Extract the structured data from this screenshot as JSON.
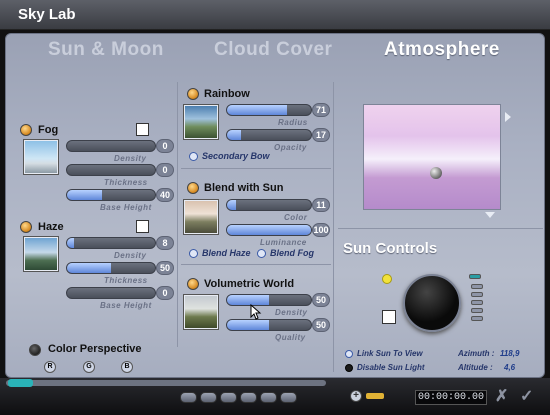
{
  "app": {
    "title": "Sky Lab"
  },
  "tabs": [
    {
      "label": "Sun & Moon",
      "active": false
    },
    {
      "label": "Cloud Cover",
      "active": false
    },
    {
      "label": "Atmosphere",
      "active": true
    }
  ],
  "fog": {
    "label": "Fog",
    "sliders": [
      {
        "caption": "Density",
        "value": "0",
        "fraction": 0.0
      },
      {
        "caption": "Thickness",
        "value": "0",
        "fraction": 0.0
      },
      {
        "caption": "Base Height",
        "value": "40",
        "fraction": 0.4
      }
    ]
  },
  "haze": {
    "label": "Haze",
    "sliders": [
      {
        "caption": "Density",
        "value": "8",
        "fraction": 0.08
      },
      {
        "caption": "Thickness",
        "value": "50",
        "fraction": 0.5
      },
      {
        "caption": "Base Height",
        "value": "0",
        "fraction": 0.0
      }
    ]
  },
  "rainbow": {
    "label": "Rainbow",
    "sliders": [
      {
        "caption": "Radius",
        "value": "71",
        "fraction": 0.71
      },
      {
        "caption": "Opacity",
        "value": "17",
        "fraction": 0.17
      }
    ],
    "option": "Secondary Bow"
  },
  "blend": {
    "label": "Blend with Sun",
    "sliders": [
      {
        "caption": "Color",
        "value": "11",
        "fraction": 0.11
      },
      {
        "caption": "Luminance",
        "value": "100",
        "fraction": 1.0
      }
    ],
    "options": [
      "Blend Haze",
      "Blend Fog"
    ]
  },
  "volumetric": {
    "label": "Volumetric World",
    "sliders": [
      {
        "caption": "Density",
        "value": "50",
        "fraction": 0.5
      },
      {
        "caption": "Quality",
        "value": "50",
        "fraction": 0.5
      }
    ]
  },
  "color_perspective": {
    "label": "Color Perspective",
    "channels": [
      "R",
      "G",
      "B"
    ]
  },
  "sun_controls": {
    "title": "Sun Controls",
    "link_label": "Link Sun To View",
    "disable_label": "Disable Sun Light",
    "azimuth_label": "Azimuth :",
    "azimuth_value": "118,9",
    "altitude_label": "Altitude :",
    "altitude_value": "4,6"
  },
  "timeline": {
    "time": "00:00:00.00"
  },
  "colors": {
    "accent_fill": "#5f86d9",
    "sun_dot": "#f2e23a"
  }
}
